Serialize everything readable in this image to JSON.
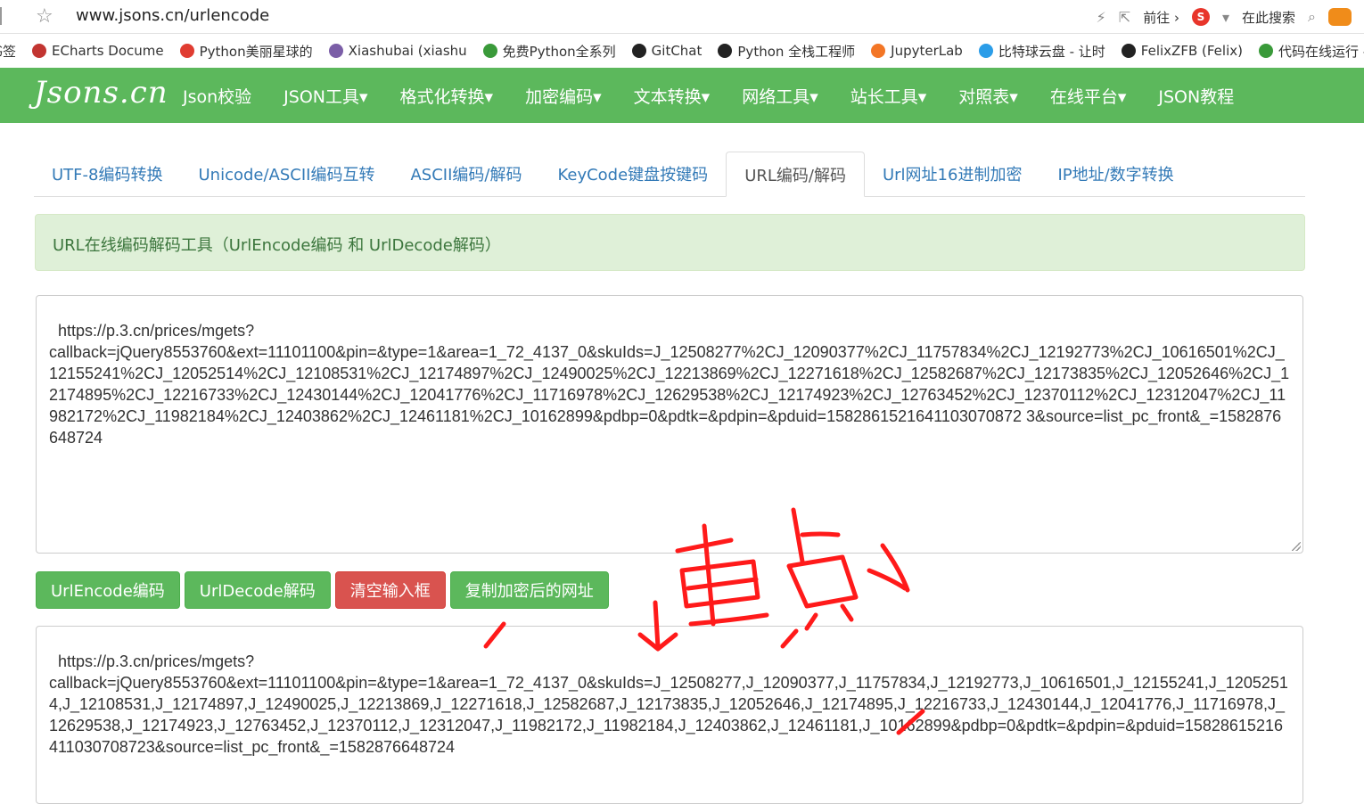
{
  "browser": {
    "url": "www.jsons.cn/urlencode",
    "forward_label": "前往",
    "search_label": "在此搜索"
  },
  "bookmarks": [
    {
      "label": "书签",
      "color": "#888888"
    },
    {
      "label": "ECharts Docume",
      "color": "#c23531"
    },
    {
      "label": "Python美丽星球的",
      "color": "#e03c31"
    },
    {
      "label": "Xiashubai (xiashu",
      "color": "#7b5ea7"
    },
    {
      "label": "免费Python全系列",
      "color": "#3a9a3a"
    },
    {
      "label": "GitChat",
      "color": "#222222"
    },
    {
      "label": "Python 全栈工程师",
      "color": "#222222"
    },
    {
      "label": "JupyterLab",
      "color": "#f37626"
    },
    {
      "label": "比特球云盘 - 让时",
      "color": "#2b9de8"
    },
    {
      "label": "FelixZFB (Felix)",
      "color": "#222222"
    },
    {
      "label": "代码在线运行 - 在",
      "color": "#3a9a3a"
    }
  ],
  "navbar": {
    "brand": "Jsons.cn",
    "items": [
      "Json校验",
      "JSON工具▾",
      "格式化转换▾",
      "加密编码▾",
      "文本转换▾",
      "网络工具▾",
      "站长工具▾",
      "对照表▾",
      "在线平台▾",
      "JSON教程"
    ]
  },
  "tabs": [
    "UTF-8编码转换",
    "Unicode/ASCII编码互转",
    "ASCII编码/解码",
    "KeyCode键盘按键码",
    "URL编码/解码",
    "Url网址16进制加密",
    "IP地址/数字转换"
  ],
  "active_tab": "URL编码/解码",
  "alert_text": "URL在线编码解码工具（UrlEncode编码 和 UrlDecode解码）",
  "input_text": "https://p.3.cn/prices/mgets?\ncallback=jQuery8553760&ext=11101100&pin=&type=1&area=1_72_4137_0&skuIds=J_12508277%2CJ_12090377%2CJ_11757834%2CJ_12192773%2CJ_10616501%2CJ_12155241%2CJ_12052514%2CJ_12108531%2CJ_12174897%2CJ_12490025%2CJ_12213869%2CJ_12271618%2CJ_12582687%2CJ_12173835%2CJ_12052646%2CJ_12174895%2CJ_12216733%2CJ_12430144%2CJ_12041776%2CJ_11716978%2CJ_12629538%2CJ_12174923%2CJ_12763452%2CJ_12370112%2CJ_12312047%2CJ_11982172%2CJ_11982184%2CJ_12403862%2CJ_12461181%2CJ_10162899&pdbp=0&pdtk=&pdpin=&pduid=1582861521641103070872 3&source=list_pc_front&_=1582876648724",
  "buttons": {
    "encode": "UrlEncode编码",
    "decode": "UrlDecode解码",
    "clear": "清空输入框",
    "copy": "复制加密后的网址"
  },
  "output_text": "https://p.3.cn/prices/mgets?\ncallback=jQuery8553760&ext=11101100&pin=&type=1&area=1_72_4137_0&skuIds=J_12508277,J_12090377,J_11757834,J_12192773,J_10616501,J_12155241,J_12052514,J_12108531,J_12174897,J_12490025,J_12213869,J_12271618,J_12582687,J_12173835,J_12052646,J_12174895,J_12216733,J_12430144,J_12041776,J_11716978,J_12629538,J_12174923,J_12763452,J_12370112,J_12312047,J_11982172,J_11982184,J_12403862,J_12461181,J_10162899&pdbp=0&pdtk=&pdpin=&pduid=15828615216411030708723&source=list_pc_front&_=1582876648724",
  "annotation_text": "重点",
  "colors": {
    "brand_green": "#5cb85c",
    "danger_red": "#d9534f",
    "annotation_red": "#ff1a1a"
  }
}
